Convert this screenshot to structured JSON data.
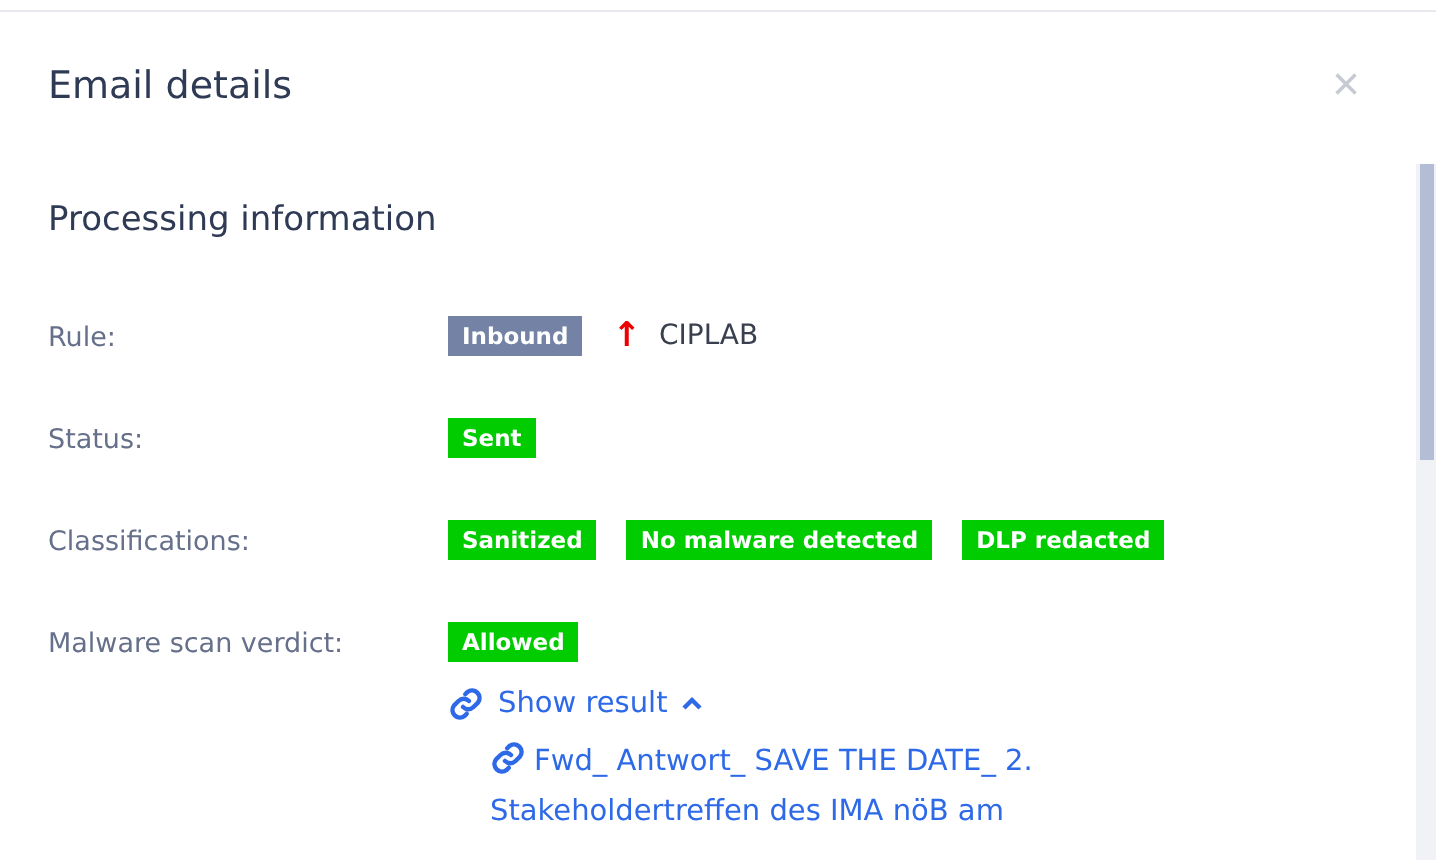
{
  "dialog": {
    "title": "Email details",
    "close_label": "×"
  },
  "section": {
    "title": "Processing information",
    "rows": [
      {
        "label": "Rule:",
        "badges": [
          {
            "text": "Inbound",
            "color": "#7482a6"
          }
        ],
        "arrow": "↑",
        "target": "CIPLAB"
      },
      {
        "label": "Status:",
        "badges": [
          {
            "text": "Sent",
            "color": "#00cc00"
          }
        ]
      },
      {
        "label": "Classifications:",
        "badges": [
          {
            "text": "Sanitized",
            "color": "#00cc00"
          },
          {
            "text": "No malware detected",
            "color": "#00cc00"
          },
          {
            "text": "DLP redacted",
            "color": "#00cc00"
          }
        ]
      },
      {
        "label": "Malware scan verdict:",
        "badges": [
          {
            "text": "Allowed",
            "color": "#00cc00"
          }
        ],
        "result": {
          "label": "Show result",
          "expanded": true,
          "files": [
            "Fwd_ Antwort_ SAVE THE DATE_ 2. Stakeholdertreffen des IMA nöB am"
          ]
        }
      }
    ]
  }
}
